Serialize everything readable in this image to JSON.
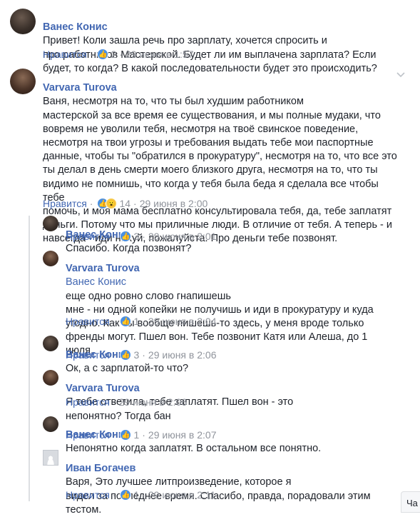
{
  "comments": [
    {
      "author": "Ванес Конис",
      "text": "Привет! Коли зашла речь про зарплату, хочется спросить и\nпро работников Мастерской. Будет ли им выплачена зарплата? Если\nбудет, то когда? В какой последовательности будет это происходить?",
      "like_label": "Нравится",
      "reaction_count": "2",
      "time": "29 июня в 1:57"
    },
    {
      "author": "Varvara Turova",
      "text": "Ваня, несмотря на то, что ты был худшим работником\nмастерской за все время ее существования, и мы полные мудаки, что\nвовремя не уволили тебя, несмотря на твоё свинское поведение,\nнесмотря на твои угрозы и требования выдать тебе мои паспортные\nданные, чтобы ты \"обратился в прокуратуру\", несмотря на то, что все это\nты делал в день смерти моего близкого друга, несмотря на то, что ты\nвидимо не помнишь, что когда у тебя была беда я сделала все чтобы тебе\nпомочь, и моя мама бесплатно консультировала тебя, да, тебе заплатят\nденьги. Потому что мы приличные люди. В отличие от тебя. А теперь - и\nнавсегда - иди нахуй, пожалуйста. Про деньги тебе позвонят.",
      "like_label": "Нравится",
      "reaction_count": "14",
      "time": "29 июня в 2:00"
    },
    {
      "author": "Ванес Конис",
      "text": "Спасибо. Когда позвонят?",
      "like_label": "Нравится",
      "reaction_count": "3",
      "time": "29 июня в 2:01"
    },
    {
      "author": "Varvara Turova",
      "mention": "Ванес Конис",
      "text": "еще одно ровно слово гнапишешь\nмне - ни одной копейки не получишь и иди в прокуратуру и куда\nугодно. Как ты вообще пишешь-то здесь, у меня вроде только\nфренды могут. Пшел вон. Тебе позвонит Катя или Алеша, до 1\nиюля.",
      "like_label": "Нравится",
      "reaction_count": "1",
      "time": "29 июня в 2:04"
    },
    {
      "author": "Ванес Конис",
      "text": "Ок, а с зарплатой-то что?",
      "like_label": "Нравится",
      "reaction_count": "3",
      "time": "29 июня в 2:06"
    },
    {
      "author": "Varvara Turova",
      "text": "Я тебе ответила, тебе заплатят. Пшел вон - это\nнепонятно? Тогда бан",
      "like_label": "Нравится",
      "time": "29 июня в 2:06"
    },
    {
      "author": "Ванес Конис",
      "text": "Непонятно когда заплатят. В остальном все понятно.",
      "like_label": "Нравится",
      "reaction_count": "1",
      "time": "29 июня в 2:07"
    },
    {
      "author": "Иван Богачев",
      "text": "Варя, Это лучшее литпроизведение, которое я\nвидел за последнее время. Спасибо, правда, порадовали этим\nтестом.",
      "like_label": "Нравится",
      "reaction_count": "1",
      "time": "29 июня в 2:11"
    }
  ],
  "chat_tab_label": "Ча",
  "icons": {
    "like": "thumbs-up-icon",
    "wow": "wow-reaction-icon",
    "options": "chevron-down-icon"
  },
  "colors": {
    "author": "#4267b2",
    "meta": "#90949c",
    "text": "#1d2129",
    "like_reaction": "#4a90e2",
    "wow_reaction": "#f7c948"
  }
}
